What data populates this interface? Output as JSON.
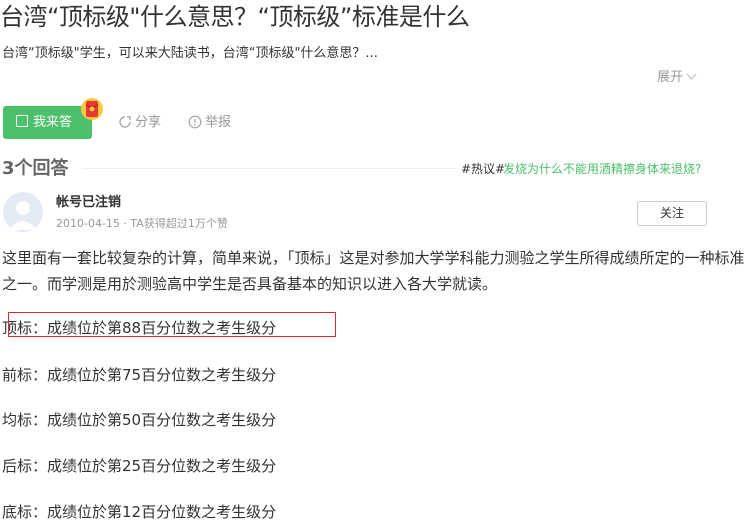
{
  "question": {
    "title": "台湾“顶标级\"什么意思？“顶标级”标准是什么",
    "description": "台湾“顶标级\"学生，可以来大陆读书，台湾“顶标级\"什么意思？...",
    "expand_label": "展开"
  },
  "actions": {
    "answer_label": "我来答",
    "share_label": "分享",
    "report_label": "举报"
  },
  "answers_header": {
    "count_label": "3个回答",
    "hot_tag": "#热议#",
    "hot_link": "发烧为什么不能用酒精擦身体来退烧?"
  },
  "answer": {
    "username": "帐号已注销",
    "date": "2010-04-15",
    "meta_suffix": "· TA获得超过1万个赞",
    "follow_label": "关注",
    "paragraph": "这里面有一套比较复杂的计算，简单来说，「顶标」这是对参加大学学科能力测验之学生所得成绩所定的一种标准之一。而学测是用於测验高中学生是否具备基本的知识以进入各大学就读。",
    "grades": [
      "顶标：成绩位於第88百分位数之考生级分",
      "前标：成绩位於第75百分位数之考生级分",
      "均标：成绩位於第50百分位数之考生级分",
      "后标：成绩位於第25百分位数之考生级分",
      "底标：成绩位於第12百分位数之考生级分"
    ]
  },
  "icons": {
    "answer": "pen-square-icon",
    "redpack": "red-envelope-icon",
    "share": "share-icon",
    "report": "report-icon",
    "expand": "chevron-down-icon",
    "avatar": "default-avatar-icon"
  },
  "colors": {
    "accent_green": "#4cc06b",
    "highlight_red": "#e0292d",
    "muted": "#999999",
    "text": "#333333"
  }
}
